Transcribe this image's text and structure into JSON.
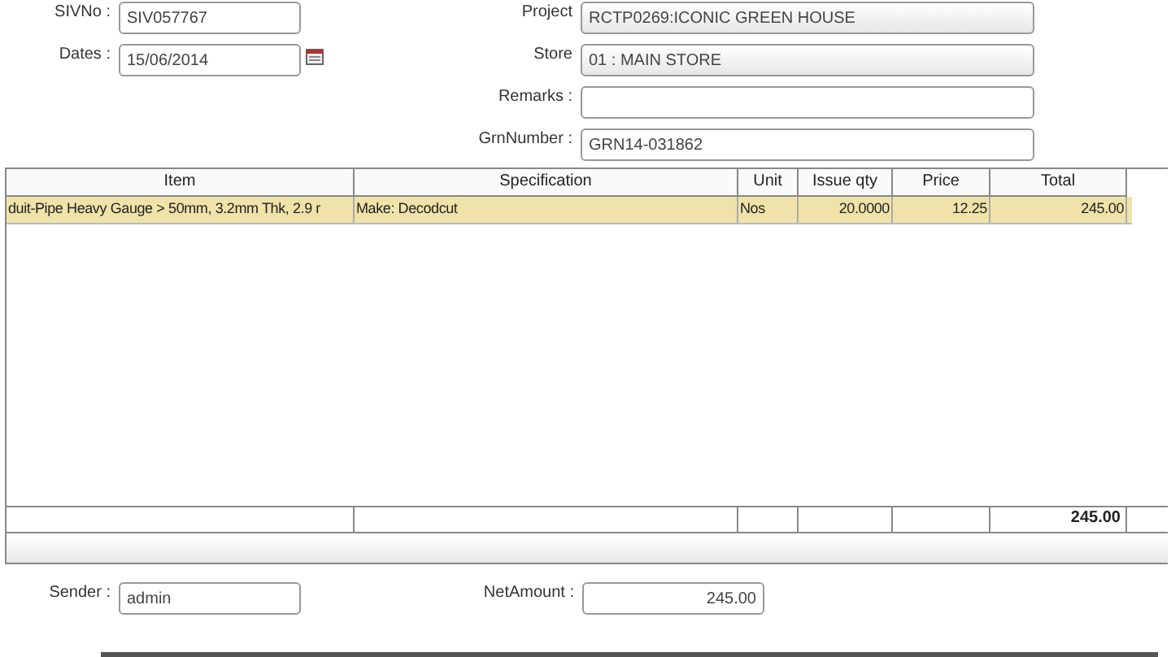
{
  "form_left": [
    {
      "label": "SIVNo :",
      "value": "SIV057767",
      "calendar": false
    },
    {
      "label": "Dates :",
      "value": "15/06/2014",
      "calendar": true
    }
  ],
  "form_right": [
    {
      "label": "Project",
      "value": "RCTP0269:ICONIC GREEN HOUSE",
      "kind": "select"
    },
    {
      "label": "Store",
      "value": "01 : MAIN STORE",
      "kind": "select"
    },
    {
      "label": "Remarks :",
      "kind": "text"
    },
    {
      "label": "GrnNumber :",
      "value": "GRN14-031862",
      "kind": "text"
    }
  ],
  "table": {
    "columns": [
      "Item",
      "Specification",
      "Unit",
      "Issue qty",
      "Price",
      "Total"
    ],
    "rows": [
      {
        "selected": true,
        "cells": [
          "duit-Pipe Heavy Gauge > 50mm, 3.2mm Thk, 2.9 r",
          "Make: Decodcut",
          "Nos",
          "20.0000",
          "12.25",
          "245.00"
        ]
      }
    ],
    "footer_total": "245.00"
  },
  "bottom": [
    {
      "label": "Sender :",
      "value": "admin",
      "kind": "text"
    },
    {
      "label": "NetAmount :",
      "value": "245.00",
      "kind": "amount"
    }
  ]
}
